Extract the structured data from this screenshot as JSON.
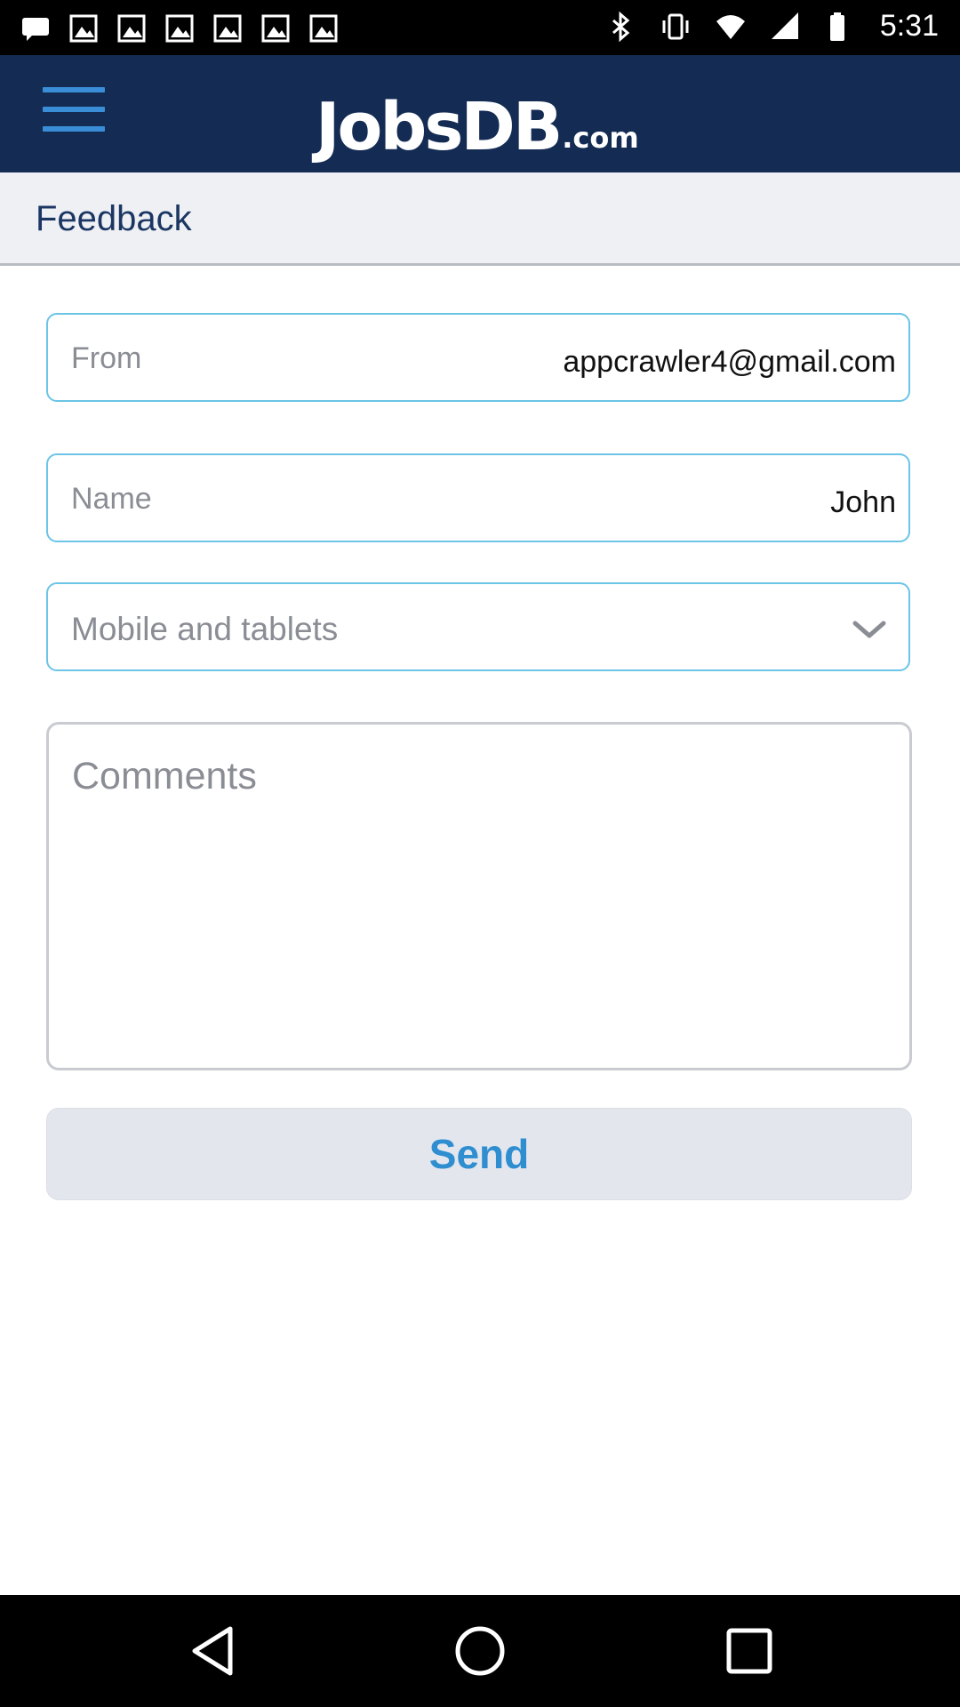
{
  "status_bar": {
    "time": "5:31",
    "left_icons": [
      "message-icon",
      "image-icon",
      "image-icon",
      "image-icon",
      "image-icon",
      "image-icon",
      "image-icon"
    ],
    "right_icons": [
      "bluetooth-icon",
      "vibrate-icon",
      "wifi-icon",
      "signal-icon",
      "battery-icon"
    ]
  },
  "header": {
    "logo_main": "JobsDB",
    "logo_sub": ".com"
  },
  "page": {
    "title": "Feedback"
  },
  "form": {
    "from_label": "From",
    "from_value": "appcrawler4@gmail.com",
    "name_label": "Name",
    "name_value": "John",
    "category_selected": "Mobile and tablets",
    "comments_placeholder": "Comments",
    "send_label": "Send"
  },
  "colors": {
    "header_bg": "#142c54",
    "accent": "#2f8ed0",
    "field_border": "#6cc4e6"
  }
}
